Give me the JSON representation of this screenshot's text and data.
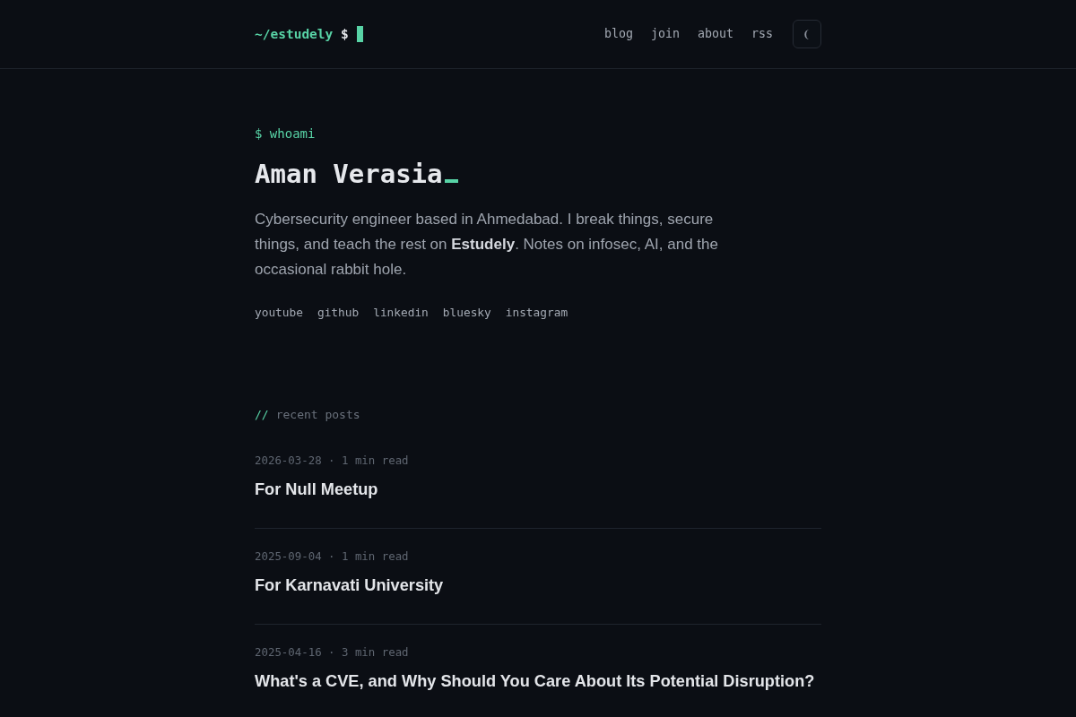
{
  "header": {
    "logo": {
      "path": "~/estudely",
      "prompt": "$"
    },
    "nav": [
      {
        "label": "blog"
      },
      {
        "label": "join"
      },
      {
        "label": "about"
      },
      {
        "label": "rss"
      }
    ]
  },
  "hero": {
    "command": "$ whoami",
    "name": "Aman Verasia",
    "bio": "Cybersecurity engineer based in Ahmedabad. I break things, secure things, and teach the rest on **Estudely**. Notes on infosec, AI, and the occasional rabbit hole.",
    "socials": [
      "youtube",
      "github",
      "linkedin",
      "bluesky",
      "instagram"
    ]
  },
  "recent_posts": {
    "marker": "//",
    "title": "recent posts",
    "posts": [
      {
        "meta": "2026-03-28 · 1 min read",
        "title": "For Null Meetup"
      },
      {
        "meta": "2025-09-04 · 1 min read",
        "title": "For Karnavati University"
      },
      {
        "meta": "2025-04-16 · 3 min read",
        "title": "What's a CVE, and Why Should You Care About Its Potential Disruption?"
      }
    ]
  }
}
